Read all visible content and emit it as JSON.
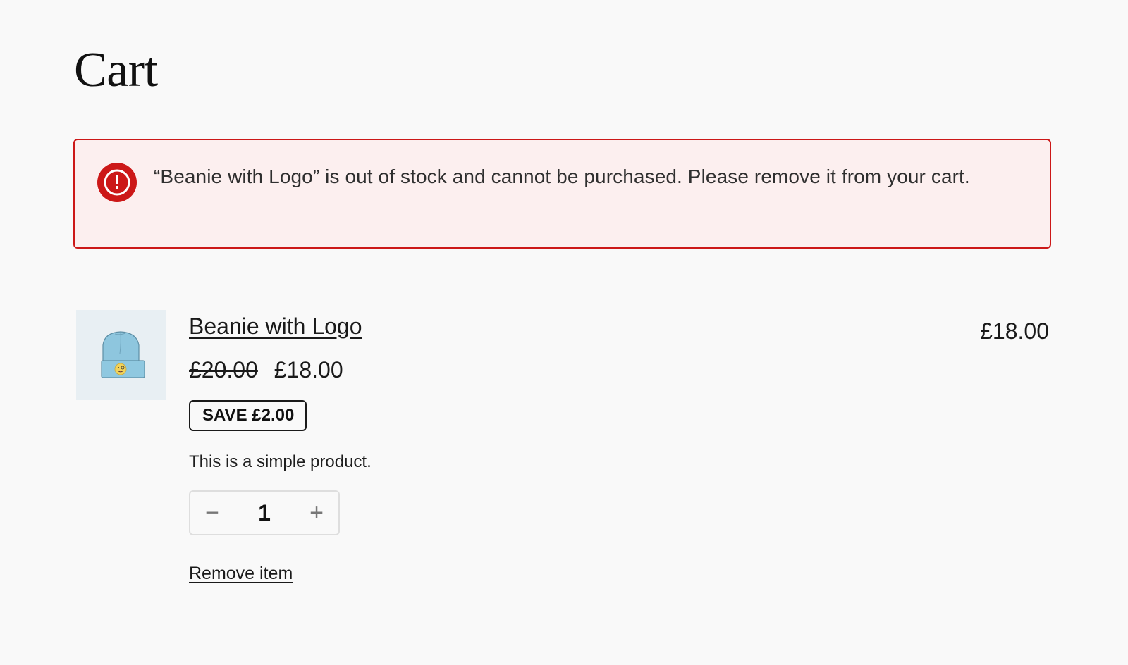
{
  "page": {
    "title": "Cart"
  },
  "notice": {
    "type": "error",
    "icon": "alert-circle-icon",
    "message": "“Beanie with Logo” is out of stock and cannot be purchased. Please remove it from your cart.",
    "colors": {
      "border": "#cc1818",
      "background": "#fcefef",
      "icon": "#cc1818"
    }
  },
  "cart": {
    "items": [
      {
        "name": "Beanie with Logo",
        "image_alt": "Beanie with Logo",
        "regular_price": "£20.00",
        "sale_price": "£18.00",
        "save_badge": "SAVE £2.00",
        "description": "This is a simple product.",
        "quantity": "1",
        "decrease_label": "−",
        "increase_label": "+",
        "remove_label": "Remove item",
        "line_total": "£18.00"
      }
    ]
  }
}
